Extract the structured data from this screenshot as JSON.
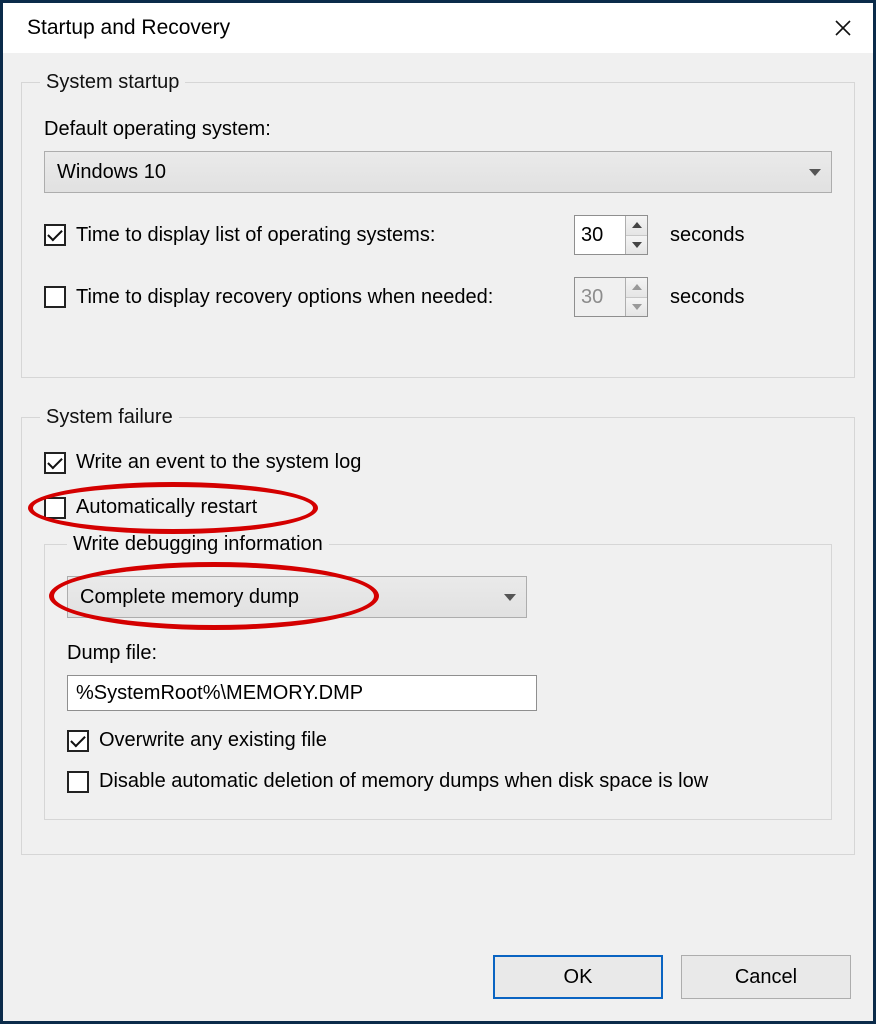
{
  "title": "Startup and Recovery",
  "system_startup": {
    "legend": "System startup",
    "default_os_label": "Default operating system:",
    "default_os_value": "Windows 10",
    "display_list": {
      "checked": true,
      "label": "Time to display list of operating systems:",
      "value": "30",
      "unit": "seconds"
    },
    "display_recovery": {
      "checked": false,
      "label": "Time to display recovery options when needed:",
      "value": "30",
      "unit": "seconds"
    }
  },
  "system_failure": {
    "legend": "System failure",
    "write_event": {
      "checked": true,
      "label": "Write an event to the system log"
    },
    "auto_restart": {
      "checked": false,
      "label": "Automatically restart"
    },
    "debug_info": {
      "legend": "Write debugging information",
      "select_value": "Complete memory dump",
      "dump_file_label": "Dump file:",
      "dump_file_value": "%SystemRoot%\\MEMORY.DMP",
      "overwrite": {
        "checked": true,
        "label": "Overwrite any existing file"
      },
      "disable_autodelete": {
        "checked": false,
        "label": "Disable automatic deletion of memory dumps when disk space is low"
      }
    }
  },
  "buttons": {
    "ok": "OK",
    "cancel": "Cancel"
  },
  "annotations": {
    "auto_restart_highlight": "red-ellipse",
    "dump_type_highlight": "red-ellipse"
  }
}
